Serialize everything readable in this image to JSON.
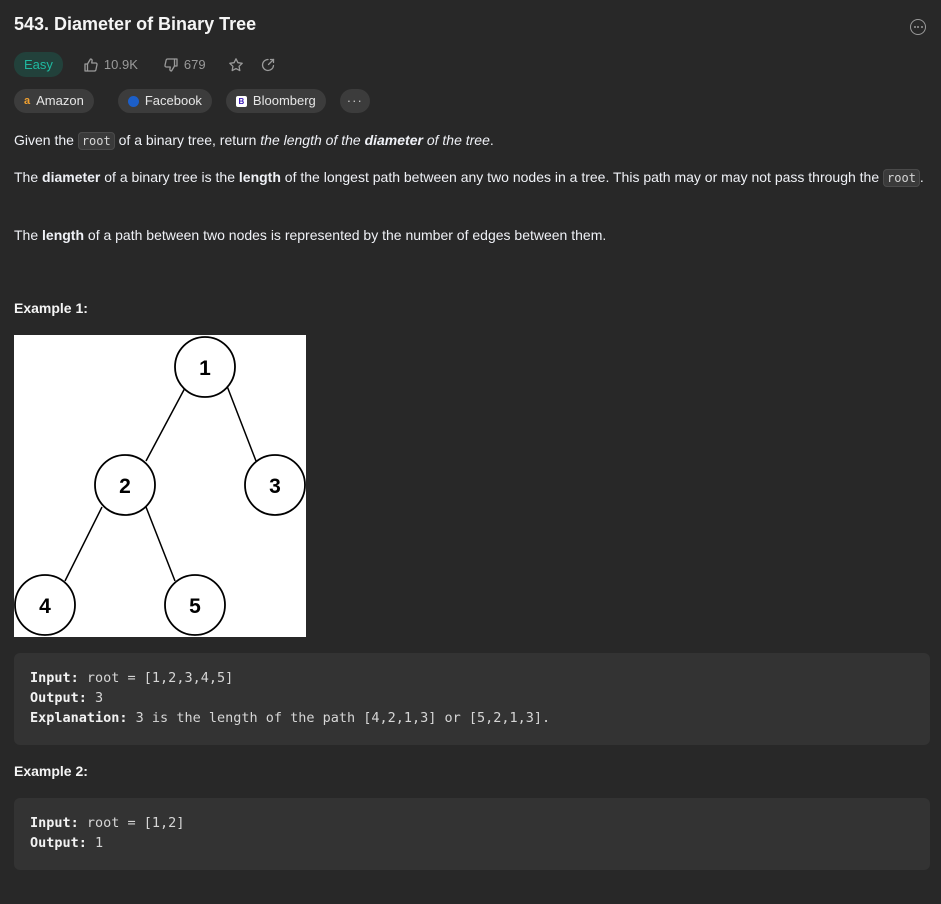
{
  "problem": {
    "title": "543. Diameter of Binary Tree",
    "difficulty": "Easy",
    "likes": "10.9K",
    "dislikes": "679"
  },
  "companies": [
    {
      "name": "Amazon"
    },
    {
      "name": "Facebook"
    },
    {
      "name": "Bloomberg"
    }
  ],
  "more_label": "···",
  "description": {
    "p1_a": "Given the ",
    "p1_code": "root",
    "p1_b": " of a binary tree, return ",
    "p1_c": "the length of the ",
    "p1_d": "diameter",
    "p1_e": " of the tree",
    "p1_f": ".",
    "p2_a": "The ",
    "p2_b": "diameter",
    "p2_c": " of a binary tree is the ",
    "p2_d": "length",
    "p2_e": " of the longest path between any two nodes in a tree. This path may or may not pass through the ",
    "p2_code": "root",
    "p2_f": ".",
    "p3_a": "The ",
    "p3_b": "length",
    "p3_c": " of a path between two nodes is represented by the number of edges between them."
  },
  "example1": {
    "heading": "Example 1:",
    "tree_nodes": [
      "1",
      "2",
      "3",
      "4",
      "5"
    ],
    "input_label": "Input:",
    "input_value": " root = [1,2,3,4,5]",
    "output_label": "Output:",
    "output_value": " 3",
    "explanation_label": "Explanation:",
    "explanation_value": " 3 is the length of the path [4,2,1,3] or [5,2,1,3]."
  },
  "example2": {
    "heading": "Example 2:",
    "input_label": "Input:",
    "input_value": " root = [1,2]",
    "output_label": "Output:",
    "output_value": " 1"
  },
  "colors": {
    "background": "#282828",
    "easy": "#1fb9a0",
    "text": "#eff1f6"
  }
}
